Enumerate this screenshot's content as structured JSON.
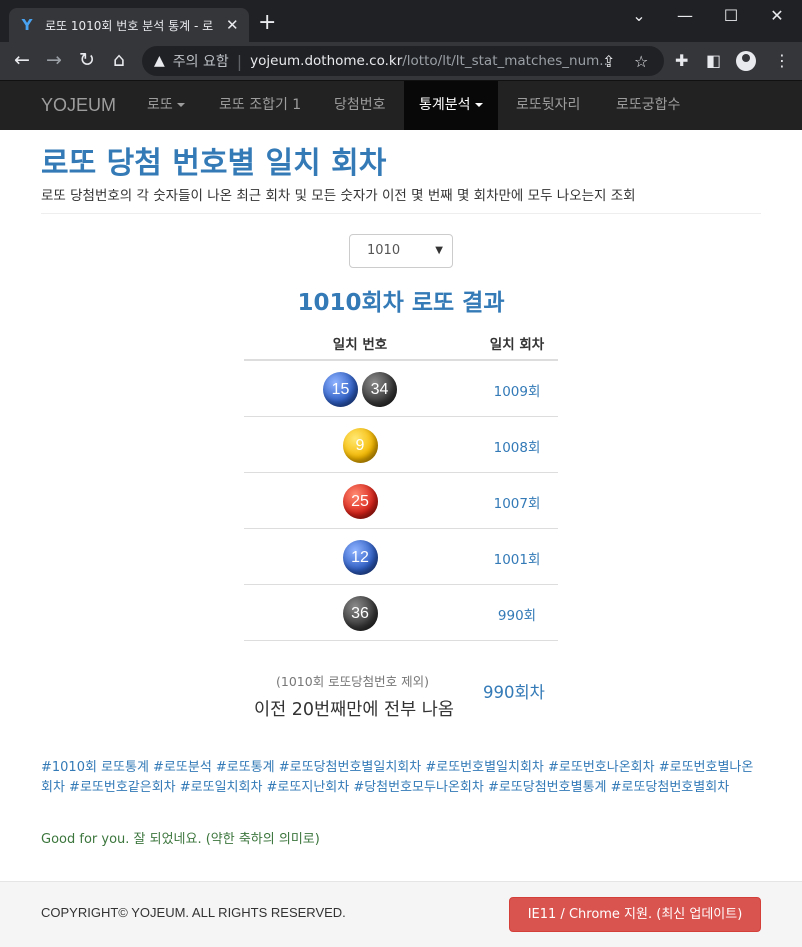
{
  "browser": {
    "tab_title": "로또 1010회 번호 분석 통계 - 로",
    "tab_favicon": "Y",
    "url_warning": "주의 요함",
    "url_host": "yojeum.dothome.co.kr",
    "url_path": "/lotto/lt/lt_stat_matches_num..."
  },
  "nav": {
    "brand": "YOJEUM",
    "items": [
      {
        "label": "로또",
        "dropdown": true
      },
      {
        "label": "로또 조합기 1",
        "dropdown": false
      },
      {
        "label": "당첨번호",
        "dropdown": false
      },
      {
        "label": "통계분석",
        "dropdown": true,
        "active": true
      },
      {
        "label": "로또뒷자리",
        "dropdown": false
      },
      {
        "label": "로또궁합수",
        "dropdown": false
      }
    ]
  },
  "page": {
    "title": "로또 당첨 번호별 일치 회차",
    "description": "로또 당첨번호의 각 숫자들이 나온 최근 회차 및 모든 숫자가 이전 몇 번째 몇 회차만에 모두 나오는지 조회",
    "selected_round": "1010",
    "result_title": "1010회차 로또 결과"
  },
  "table": {
    "headers": [
      "일치 번호",
      "일치 회차"
    ],
    "rows": [
      {
        "balls": [
          {
            "n": "15",
            "color": "blue"
          },
          {
            "n": "34",
            "color": "gray"
          }
        ],
        "round": "1009회"
      },
      {
        "balls": [
          {
            "n": "9",
            "color": "yellow"
          }
        ],
        "round": "1008회"
      },
      {
        "balls": [
          {
            "n": "25",
            "color": "red"
          }
        ],
        "round": "1007회"
      },
      {
        "balls": [
          {
            "n": "12",
            "color": "blue"
          }
        ],
        "round": "1001회"
      },
      {
        "balls": [
          {
            "n": "36",
            "color": "gray"
          }
        ],
        "round": "990회"
      }
    ]
  },
  "summary": {
    "note": "(1010회 로또당첨번호 제외)",
    "main": "이전 20번째만에 전부 나옴",
    "count": "990회차"
  },
  "tags": "#1010회 로또통계 #로또분석 #로또통계 #로또당첨번호별일치회차 #로또번호별일치회차 #로또번호나온회차 #로또번호별나온회차 #로또번호같은회차 #로또일치회차 #로또지난회차 #당첨번호모두나온회차 #로또당첨번호별통계 #로또당첨번호별회차",
  "good_message": "Good for you. 잘 되었네요. (약한 축하의 의미로)",
  "footer": {
    "copyright": "COPYRIGHT© YOJEUM. ALL RIGHTS RESERVED.",
    "support_button": "IE11 / Chrome 지원. (최신 업데이트)"
  },
  "colors": {
    "link": "#337ab7",
    "navbar": "#222222",
    "danger": "#d9534f",
    "success_text": "#3c763d"
  }
}
